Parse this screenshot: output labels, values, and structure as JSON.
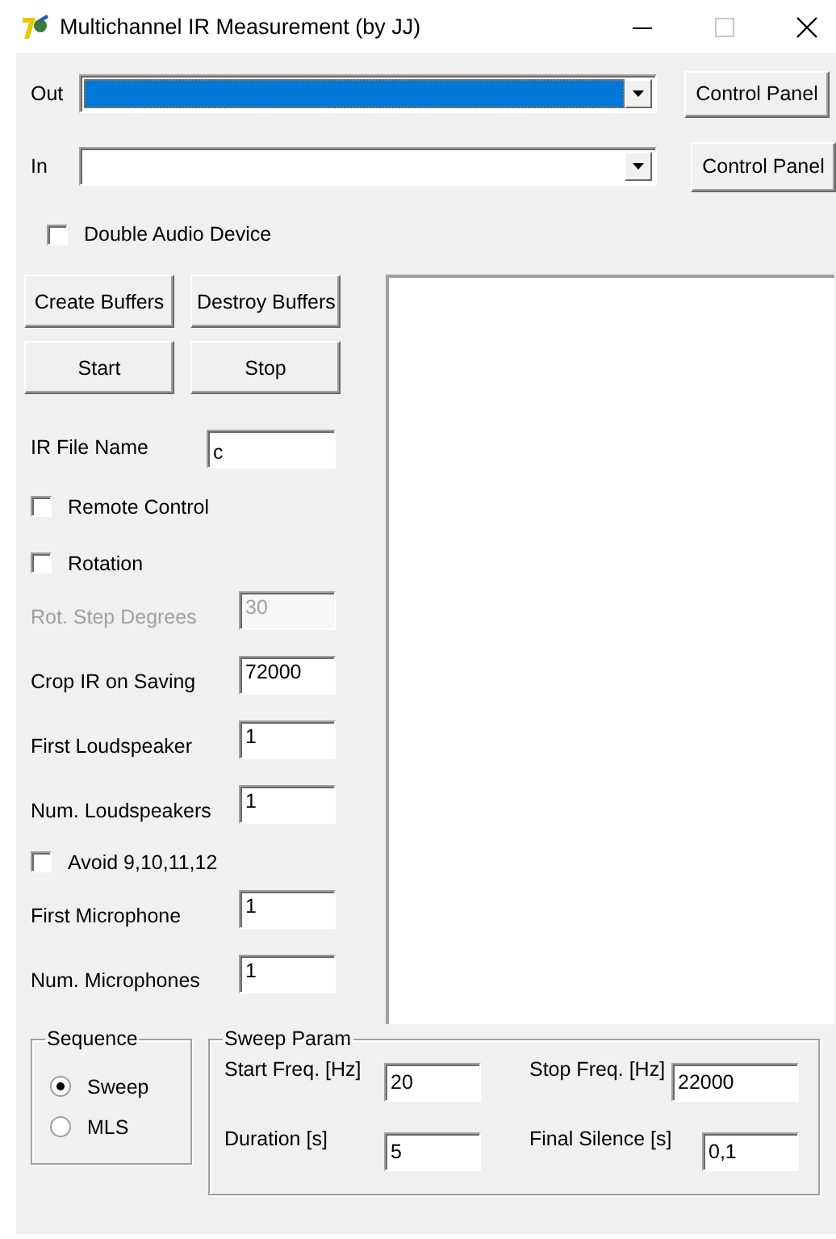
{
  "window": {
    "title": "Multichannel IR Measurement (by JJ)"
  },
  "devices": [
    {
      "label": "Out",
      "focused": true,
      "button": "Control Panel"
    },
    {
      "label": "In",
      "focused": false,
      "button": "Control Panel"
    }
  ],
  "double_audio_device": {
    "label": "Double Audio Device",
    "checked": false
  },
  "buttons": [
    "Create Buffers",
    "Destroy Buffers",
    "Start",
    "Stop"
  ],
  "settings": [
    {
      "kind": "field",
      "label": "IR File Name",
      "value": "c",
      "disabled": false
    },
    {
      "kind": "checkbox",
      "label": "Remote Control",
      "checked": false
    },
    {
      "kind": "checkbox",
      "label": "Rotation",
      "checked": false
    },
    {
      "kind": "field",
      "label": "Rot. Step Degrees",
      "value": "30",
      "disabled": true
    },
    {
      "kind": "field",
      "label": "Crop IR on Saving",
      "value": "72000",
      "disabled": false
    },
    {
      "kind": "field",
      "label": "First Loudspeaker",
      "value": "1",
      "disabled": false
    },
    {
      "kind": "field",
      "label": "Num. Loudspeakers",
      "value": "1",
      "disabled": false
    },
    {
      "kind": "checkbox",
      "label": "Avoid 9,10,11,12",
      "checked": false
    },
    {
      "kind": "field",
      "label": "First Microphone",
      "value": "1",
      "disabled": false
    },
    {
      "kind": "field",
      "label": "Num. Microphones",
      "value": "1",
      "disabled": false
    }
  ],
  "sequence": {
    "title": "Sequence",
    "options": [
      {
        "label": "Sweep",
        "selected": true
      },
      {
        "label": "MLS",
        "selected": false
      }
    ]
  },
  "sweep_param": {
    "title": "Sweep Param",
    "fields": [
      {
        "label": "Start Freq. [Hz]",
        "value": "20"
      },
      {
        "label": "Stop Freq. [Hz]",
        "value": "22000"
      },
      {
        "label": "Duration [s]",
        "value": "5"
      },
      {
        "label": "Final Silence [s]",
        "value": "0,1"
      }
    ]
  }
}
